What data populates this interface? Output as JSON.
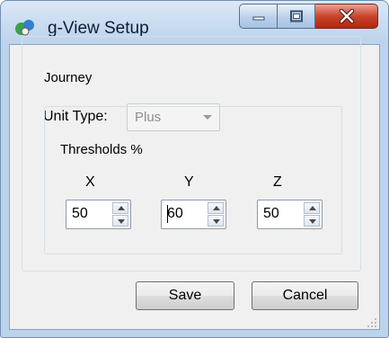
{
  "window": {
    "title": "g-View Setup"
  },
  "journey": {
    "group_label": "Journey",
    "unit_type_label": "Unit Type:",
    "unit_type_value": "Plus"
  },
  "thresholds": {
    "group_label": "Thresholds %",
    "x": {
      "label": "X",
      "value": "50"
    },
    "y": {
      "label": "Y",
      "value": "60"
    },
    "z": {
      "label": "Z",
      "value": "50"
    }
  },
  "buttons": {
    "save": "Save",
    "cancel": "Cancel"
  },
  "colors": {
    "close_button": "#c9452c",
    "title_bar": "#c9dcf0",
    "client_bg": "#f0f0f0"
  }
}
